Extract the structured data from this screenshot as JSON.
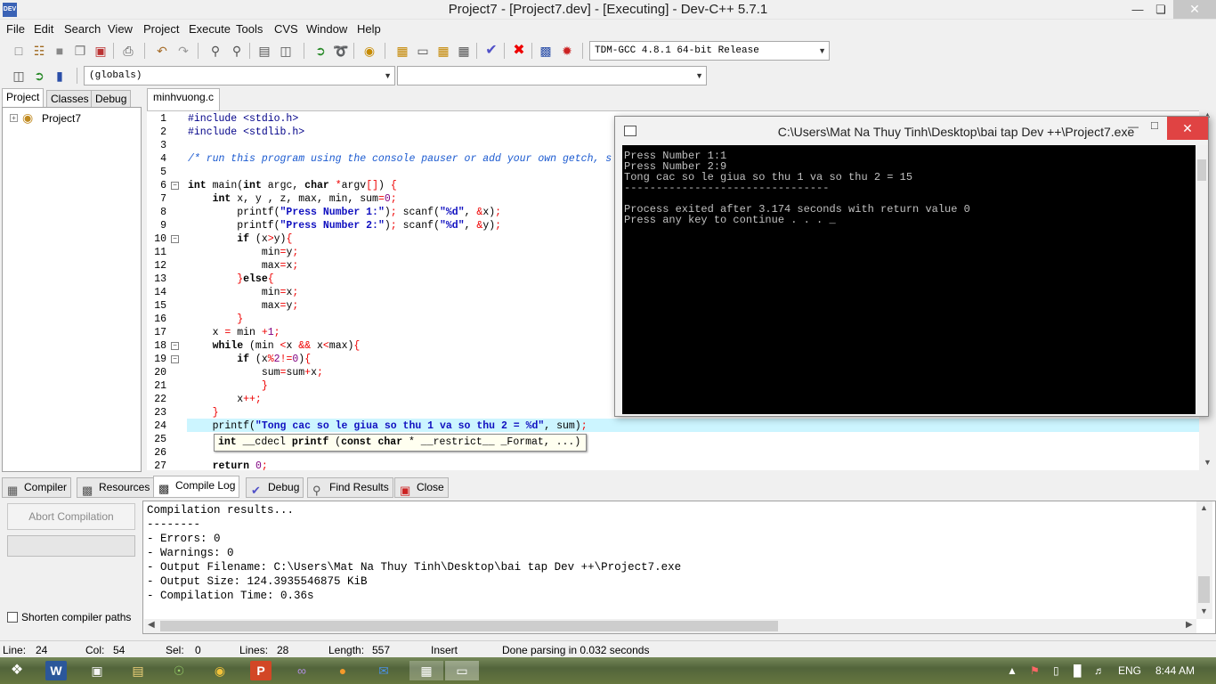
{
  "window": {
    "title": "Project7 - [Project7.dev] - [Executing] - Dev-C++ 5.7.1",
    "app_icon_text": "DEV",
    "minimize_icon": "minimize-icon",
    "maximize_icon": "maximize-icon",
    "close_icon": "close-icon"
  },
  "menu": [
    "File",
    "Edit",
    "Search",
    "View",
    "Project",
    "Execute",
    "Tools",
    "CVS",
    "Window",
    "Help"
  ],
  "toolbar": {
    "compiler_select": "TDM-GCC 4.8.1 64-bit Release",
    "scope_select": "(globals)",
    "member_select": ""
  },
  "left_tabs": [
    "Project",
    "Classes",
    "Debug"
  ],
  "project_tree": {
    "root": "Project7"
  },
  "file_tab": "minhvuong.c",
  "editor": {
    "lines": [
      {
        "n": "1",
        "html": "<span class='pp'>#include &lt;stdio.h&gt;</span>"
      },
      {
        "n": "2",
        "html": "<span class='pp'>#include &lt;stdlib.h&gt;</span>"
      },
      {
        "n": "3",
        "html": ""
      },
      {
        "n": "4",
        "html": "<span class='cm'>/* run this program using the console pauser or add your own getch, s</span>"
      },
      {
        "n": "5",
        "html": ""
      },
      {
        "n": "6",
        "html": "<span class='kw'>int</span> main(<span class='kw'>int</span> argc, <span class='kw'>char</span> <span class='sym'>*</span>argv<span class='sym'>[]</span>) <span class='sym'>{</span>",
        "fold": "−"
      },
      {
        "n": "7",
        "html": "    <span class='kw'>int</span> x, y , z, max, min, sum<span class='sym'>=</span><span class='num'>0</span><span class='sym'>;</span>"
      },
      {
        "n": "8",
        "html": "        printf(<span class='str'>\"Press Number 1:\"</span>)<span class='sym'>;</span> scanf(<span class='str'>\"%d\"</span>, <span class='sym'>&amp;</span>x)<span class='sym'>;</span>"
      },
      {
        "n": "9",
        "html": "        printf(<span class='str'>\"Press Number 2:\"</span>)<span class='sym'>;</span> scanf(<span class='str'>\"%d\"</span>, <span class='sym'>&amp;</span>y)<span class='sym'>;</span>"
      },
      {
        "n": "10",
        "html": "        <span class='kw'>if</span> (x<span class='sym'>&gt;</span>y)<span class='sym'>{</span>",
        "fold": "−"
      },
      {
        "n": "11",
        "html": "            min<span class='sym'>=</span>y<span class='sym'>;</span>"
      },
      {
        "n": "12",
        "html": "            max<span class='sym'>=</span>x<span class='sym'>;</span>"
      },
      {
        "n": "13",
        "html": "        <span class='sym'>}</span><span class='kw'>else</span><span class='sym'>{</span>"
      },
      {
        "n": "14",
        "html": "            min<span class='sym'>=</span>x<span class='sym'>;</span>"
      },
      {
        "n": "15",
        "html": "            max<span class='sym'>=</span>y<span class='sym'>;</span>"
      },
      {
        "n": "16",
        "html": "        <span class='sym'>}</span>"
      },
      {
        "n": "17",
        "html": "    x <span class='sym'>=</span> min <span class='sym'>+</span><span class='num'>1</span><span class='sym'>;</span>"
      },
      {
        "n": "18",
        "html": "    <span class='kw'>while</span> (min <span class='sym'>&lt;</span>x <span class='sym'>&amp;&amp;</span> x<span class='sym'>&lt;</span>max)<span class='sym'>{</span>",
        "fold": "−"
      },
      {
        "n": "19",
        "html": "        <span class='kw'>if</span> (x<span class='sym'>%</span><span class='num'>2</span><span class='sym'>!=</span><span class='num'>0</span>)<span class='sym'>{</span>",
        "fold": "−"
      },
      {
        "n": "20",
        "html": "            sum<span class='sym'>=</span>sum<span class='sym'>+</span>x<span class='sym'>;</span>"
      },
      {
        "n": "21",
        "html": "            <span class='sym'>}</span>"
      },
      {
        "n": "22",
        "html": "        x<span class='sym'>++;</span>"
      },
      {
        "n": "23",
        "html": "    <span class='sym'>}</span>"
      },
      {
        "n": "24",
        "html": "    printf(<span class='str'>\"Tong cac so le giua so thu 1 va so thu 2 = %d\"</span>, sum)<span class='sym'>;</span>"
      },
      {
        "n": "25",
        "html": ""
      },
      {
        "n": "26",
        "html": ""
      },
      {
        "n": "27",
        "html": "    <span class='kw'>return</span> <span class='num'>0</span><span class='sym'>;</span>"
      }
    ],
    "tooltip_html": "<span class='kw'>int</span> __cdecl <span class='kw'>printf</span> (<span class='kw'>const char</span> * __restrict__ _Format, ...)"
  },
  "console": {
    "title": "C:\\Users\\Mat Na Thuy Tinh\\Desktop\\bai tap Dev ++\\Project7.exe",
    "lines": [
      "Press Number 1:1",
      "Press Number 2:9",
      "Tong cac so le giua so thu 1 va so thu 2 = 15",
      "--------------------------------",
      "Process exited after 3.174 seconds with return value 0",
      "Press any key to continue . . . _"
    ]
  },
  "bottom_tabs": [
    "Compiler",
    "Resources",
    "Compile Log",
    "Debug",
    "Find Results",
    "Close"
  ],
  "compile_panel": {
    "abort_label": "Abort Compilation",
    "shorten_label": "Shorten compiler paths",
    "log": [
      "Compilation results...",
      "--------",
      "- Errors: 0",
      "- Warnings: 0",
      "- Output Filename: C:\\Users\\Mat Na Thuy Tinh\\Desktop\\bai tap Dev ++\\Project7.exe",
      "- Output Size: 124.3935546875 KiB",
      "- Compilation Time: 0.36s"
    ]
  },
  "status": {
    "line_label": "Line:",
    "line_val": "24",
    "col_label": "Col:",
    "col_val": "54",
    "sel_label": "Sel:",
    "sel_val": "0",
    "lines_label": "Lines:",
    "lines_val": "28",
    "length_label": "Length:",
    "length_val": "557",
    "mode": "Insert",
    "message": "Done parsing in 0.032 seconds"
  },
  "taskbar": {
    "lang": "ENG",
    "time": "8:44 AM",
    "icons": [
      "windows-start-icon",
      "word-icon",
      "paint-icon",
      "folder-icon",
      "utorrent-icon",
      "chrome-icon",
      "powerpoint-icon",
      "visual-studio-icon",
      "firefox-icon",
      "mail-icon",
      "devcpp-icon",
      "console-icon"
    ]
  }
}
